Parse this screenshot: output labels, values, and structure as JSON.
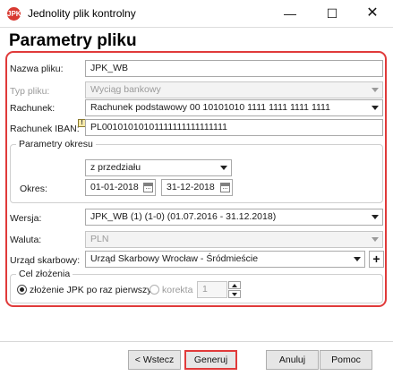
{
  "window": {
    "icon_text": "JPK",
    "title": "Jednolity plik kontrolny",
    "minimize": "—",
    "maximize": "☐",
    "close": "✕"
  },
  "page_title": "Parametry pliku",
  "form": {
    "nazwa_pliku": {
      "label": "Nazwa pliku:",
      "value": "JPK_WB"
    },
    "typ_pliku": {
      "label": "Typ pliku:",
      "value": "Wyciąg bankowy"
    },
    "rachunek": {
      "label": "Rachunek:",
      "value": "Rachunek podstawowy 00 10101010 1111 1111 1111 1111"
    },
    "rachunek_iban": {
      "label": "Rachunek IBAN:",
      "info": "!",
      "value": "PL00101010101111111111111111"
    },
    "parametry_okresu": {
      "title": "Parametry okresu",
      "range_mode": "z przedziału",
      "okres_label": "Okres:",
      "date_from": "01-01-2018",
      "date_to": "31-12-2018"
    },
    "wersja": {
      "label": "Wersja:",
      "value": "JPK_WB (1) (1-0) (01.07.2016 - 31.12.2018)"
    },
    "waluta": {
      "label": "Waluta:",
      "value": "PLN"
    },
    "urzad_skarbowy": {
      "label": "Urząd skarbowy:",
      "value": "Urząd Skarbowy Wrocław - Śródmieście",
      "add": "+"
    },
    "cel_zlozenia": {
      "title": "Cel złożenia",
      "option_first": "złożenie JPK po raz pierwszy",
      "option_correction": "korekta",
      "correction_number": "1"
    }
  },
  "buttons": {
    "back": "< Wstecz",
    "generate": "Generuj",
    "cancel": "Anuluj",
    "help": "Pomoc"
  },
  "colors": {
    "highlight": "#e03a3a"
  }
}
